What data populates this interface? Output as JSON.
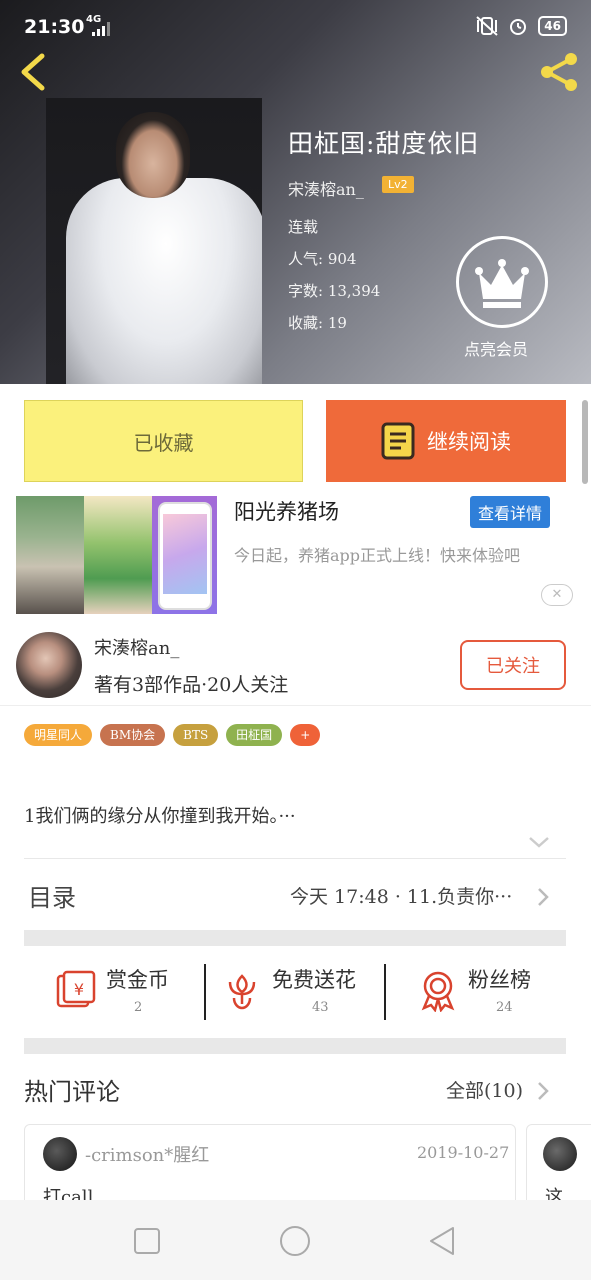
{
  "status_bar": {
    "time": "21:30",
    "network": "4G",
    "battery": "46"
  },
  "book": {
    "title": "田柾国:甜度依旧",
    "author": "宋湊榕an_",
    "author_level": "Lv2",
    "status": "连载",
    "popularity": "人气: 904",
    "word_count": "字数: 13,394",
    "favorites": "收藏: 19",
    "vip_label": "点亮会员"
  },
  "actions": {
    "saved_label": "已收藏",
    "continue_label": "继续阅读"
  },
  "ad": {
    "title": "阳光养猪场",
    "detail_button": "查看详情",
    "description": "今日起，养猪app正式上线！快来体验吧",
    "close_glyph": "✕"
  },
  "author_panel": {
    "name": "宋湊榕an_",
    "works": "著有3部作品·20人关注",
    "follow_label": "已关注"
  },
  "tags": [
    {
      "label": "明星同人",
      "color": "#f5a93a"
    },
    {
      "label": "BM协会",
      "color": "#c7734f"
    },
    {
      "label": "BTS",
      "color": "#c6a03e"
    },
    {
      "label": "田柾国",
      "color": "#8fb24f"
    },
    {
      "label": "+",
      "color": "#ef6238"
    }
  ],
  "intro": {
    "text": "1我们俩的缘分从你撞到我开始。···"
  },
  "toc": {
    "label": "目录",
    "latest": "今天 17:48 · 11.负责你···"
  },
  "stats": [
    {
      "label": "赏金币",
      "value": "2",
      "icon": "coin-envelope-icon"
    },
    {
      "label": "免费送花",
      "value": "43",
      "icon": "flower-icon"
    },
    {
      "label": "粉丝榜",
      "value": "24",
      "icon": "medal-icon"
    }
  ],
  "comments": {
    "title": "热门评论",
    "all_label": "全部(10)",
    "items": [
      {
        "user": "-crimson*腥红",
        "date": "2019-10-27",
        "text": "打call"
      },
      {
        "text": "这"
      }
    ]
  },
  "colors": {
    "accent_orange": "#ef6a3a",
    "saved_yellow": "#fbf17c",
    "link_blue": "#2f7fd9",
    "icon_red": "#d9432e"
  }
}
